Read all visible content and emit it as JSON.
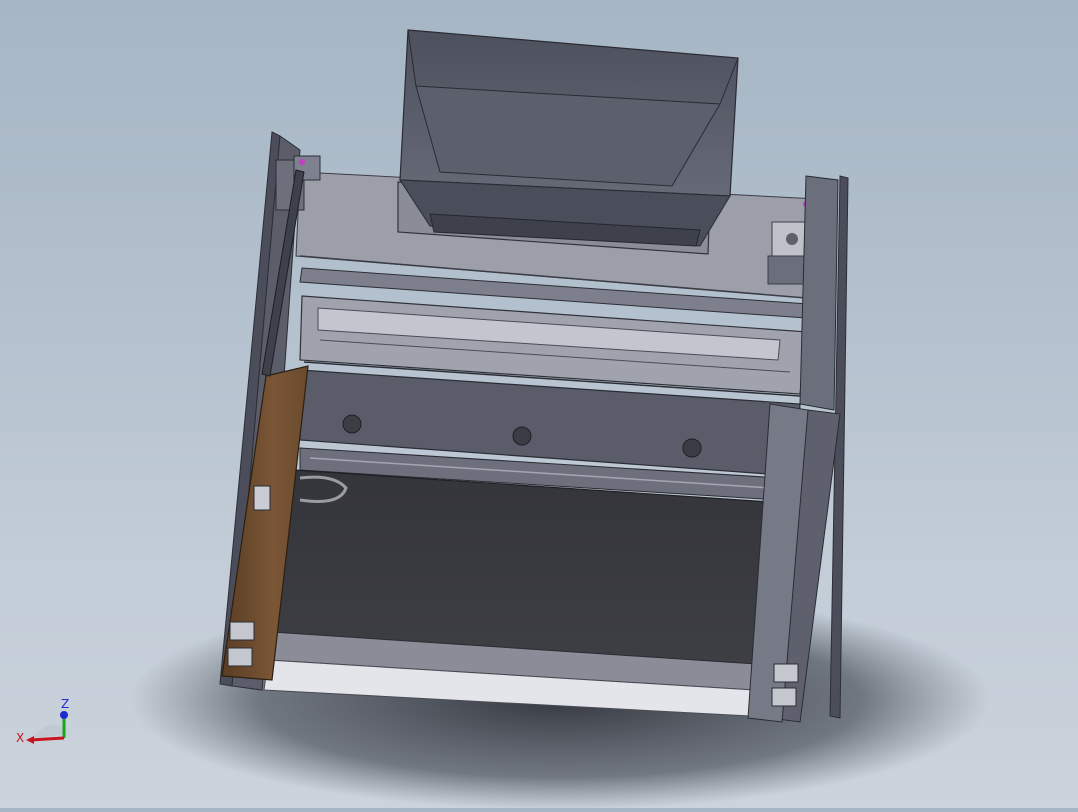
{
  "viewport": {
    "background_top": "#a6b6c5",
    "background_bottom": "#cbd3dc"
  },
  "triad": {
    "x_label": "X",
    "z_label": "Z",
    "x_color": "#c8141e",
    "z_color": "#19a519",
    "y_color": "#1e2ad2"
  },
  "colors": {
    "frame_dark": "#4b4e5a",
    "frame_mid": "#6b6f7c",
    "panel_light": "#9699a4",
    "hopper": "#5a5e6b",
    "wood": "#6b4a2e",
    "copper": "#9a4a2a",
    "bed": "#3b3c40"
  },
  "icons": {
    "triad": "coordinate-triad-icon"
  }
}
